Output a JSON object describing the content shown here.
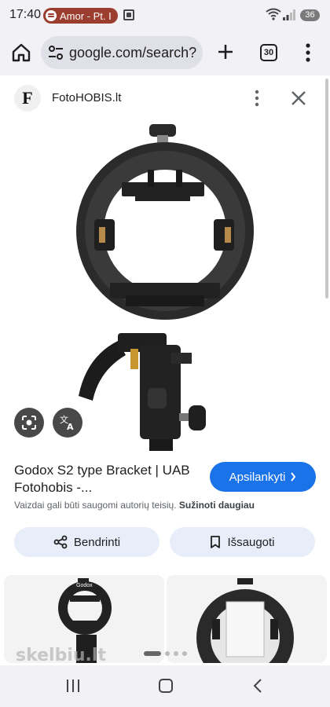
{
  "status_bar": {
    "time": "17:40",
    "media_pill": "Amor - Pt. I",
    "battery": "36"
  },
  "browser": {
    "url": "google.com/search?",
    "tab_count": "30"
  },
  "panel": {
    "site_logo": "F",
    "site_name": "FotoHOBIS.lt"
  },
  "result": {
    "title": "Godox S2 type Bracket | UAB Fotohobis -...",
    "visit_label": "Apsilankyti",
    "copyright_text": "Vaizdai gali būti saugomi autorių teisių.",
    "learn_more": "Sužinoti daugiau",
    "share_label": "Bendrinti",
    "save_label": "Išsaugoti"
  },
  "related": {
    "watermark": "skelbiu.lt",
    "thumb_1_brand": "Godox"
  },
  "colors": {
    "accent": "#1a73e8",
    "media_pill": "#9b3e2f",
    "action_bg": "#e8eef9"
  },
  "icons": [
    "home-icon",
    "tune-icon",
    "plus-icon",
    "more-vert-icon",
    "close-icon",
    "lens-icon",
    "translate-icon",
    "share-icon",
    "bookmark-icon",
    "recents-icon",
    "back-icon"
  ]
}
